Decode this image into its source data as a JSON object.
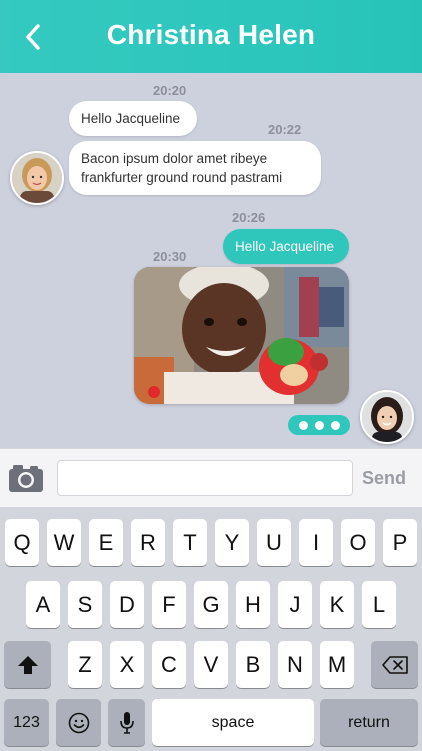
{
  "header": {
    "title": "Christina Helen",
    "back_icon": "chevron-left-icon"
  },
  "messages": {
    "time_1": "20:20",
    "msg_1": "Hello Jacqueline",
    "time_2": "20:22",
    "msg_2": "Bacon ipsum dolor amet ribeye frankfurter ground round pastrami",
    "time_3": "20:26",
    "msg_3": "Hello Jacqueline",
    "time_4": "20:30"
  },
  "composer": {
    "placeholder": "",
    "send_label": "Send"
  },
  "keyboard": {
    "row1": [
      "Q",
      "W",
      "E",
      "R",
      "T",
      "Y",
      "U",
      "I",
      "O",
      "P"
    ],
    "row2": [
      "A",
      "S",
      "D",
      "F",
      "G",
      "H",
      "J",
      "K",
      "L"
    ],
    "row3": [
      "Z",
      "X",
      "C",
      "V",
      "B",
      "N",
      "M"
    ],
    "numbers_label": "123",
    "space_label": "space",
    "return_label": "return"
  },
  "colors": {
    "accent": "#2fc6bc",
    "background": "#cdd0dd"
  }
}
